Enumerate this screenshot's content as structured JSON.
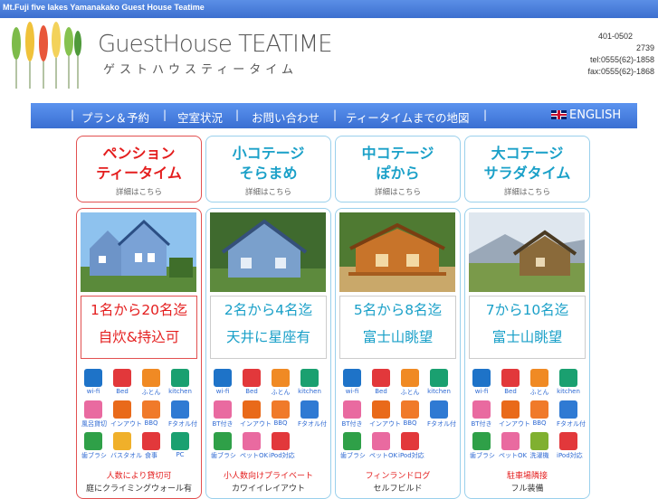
{
  "top_strip": "Mt.Fuji five lakes Yamanakako Guest House Teatime",
  "brand": "GuestHouse TEATIME",
  "brand_kana": "ゲストハウスティータイム",
  "address": {
    "line1": "401-0502",
    "line2": "2739",
    "tel": "tel:0555(62)-1858",
    "fax": "fax:0555(62)-1868"
  },
  "nav": {
    "items": [
      "プラン＆予約",
      "空室状況",
      "お問い合わせ",
      "ティータイムまでの地図"
    ],
    "english": "ENGLISH",
    "separator": "|"
  },
  "columns": [
    {
      "title1": "ペンション",
      "title2": "ティータイム",
      "detail": "詳細はこちら",
      "cap1": "1名から20名迄",
      "cap2": "自炊&持込可",
      "icons": [
        [
          "wifi-icon",
          "wi-fi"
        ],
        [
          "bed-icon",
          "Bed"
        ],
        [
          "futon-icon",
          "ふとん"
        ],
        [
          "kitchen-icon",
          "kitchen"
        ],
        [
          "bath-icon",
          "風呂貸切"
        ],
        [
          "checkin-icon",
          "インアウト"
        ],
        [
          "bbq-icon",
          "BBQ"
        ],
        [
          "towel-icon",
          "Fタオル付"
        ],
        [
          "toiletry-icon",
          "歯ブラシ"
        ],
        [
          "bathtowel-icon",
          "バスタオル"
        ],
        [
          "meal-icon",
          "食事"
        ],
        [
          "pc-icon",
          "PC"
        ]
      ],
      "bottom1": "人数により貸切可",
      "bottom2": "庭にクライミングウォール有"
    },
    {
      "title1": "小コテージ",
      "title2": "そらまめ",
      "detail": "詳細はこちら",
      "cap1": "2名から4名迄",
      "cap2": "天井に星座有",
      "icons": [
        [
          "wifi-icon",
          "wi-fi"
        ],
        [
          "bed-icon",
          "Bed"
        ],
        [
          "futon-icon",
          "ふとん"
        ],
        [
          "kitchen-icon",
          "kitchen"
        ],
        [
          "bath-icon",
          "BT付き"
        ],
        [
          "checkin-icon",
          "インアウト"
        ],
        [
          "bbq-icon",
          "BBQ"
        ],
        [
          "towel-icon",
          "Fタオル付"
        ],
        [
          "toiletry-icon",
          "歯ブラシ"
        ],
        [
          "pet-icon",
          "ペットOK"
        ],
        [
          "ipod-icon",
          "iPod対応"
        ]
      ],
      "bottom1": "小人数向けプライベート",
      "bottom2": "カワイイレイアウト"
    },
    {
      "title1": "中コテージ",
      "title2": "ぽから",
      "detail": "詳細はこちら",
      "cap1": "5名から8名迄",
      "cap2": "富士山眺望",
      "icons": [
        [
          "wifi-icon",
          "wi-fi"
        ],
        [
          "bed-icon",
          "Bed"
        ],
        [
          "futon-icon",
          "ふとん"
        ],
        [
          "kitchen-icon",
          "kitchen"
        ],
        [
          "bath-icon",
          "BT付き"
        ],
        [
          "checkin-icon",
          "インアウト"
        ],
        [
          "bbq-icon",
          "BBQ"
        ],
        [
          "towel-icon",
          "Fタオル付"
        ],
        [
          "toiletry-icon",
          "歯ブラシ"
        ],
        [
          "pet-icon",
          "ペットOK"
        ],
        [
          "ipod-icon",
          "iPod対応"
        ]
      ],
      "bottom1": "フィンランドログ",
      "bottom2": "セルフビルド"
    },
    {
      "title1": "大コテージ",
      "title2": "サラダタイム",
      "detail": "詳細はこちら",
      "cap1": "7から10名迄",
      "cap2": "富士山眺望",
      "icons": [
        [
          "wifi-icon",
          "wi-fi"
        ],
        [
          "bed-icon",
          "Bed"
        ],
        [
          "futon-icon",
          "ふとん"
        ],
        [
          "kitchen-icon",
          "kitchen"
        ],
        [
          "bath-icon",
          "BT付き"
        ],
        [
          "checkin-icon",
          "インアウト"
        ],
        [
          "bbq-icon",
          "BBQ"
        ],
        [
          "towel-icon",
          "Fタオル付"
        ],
        [
          "toiletry-icon",
          "歯ブラシ"
        ],
        [
          "pet-icon",
          "ペットOK"
        ],
        [
          "washer-icon",
          "洗濯機"
        ],
        [
          "ipod-icon",
          "iPod対応"
        ]
      ],
      "bottom1": "駐車場隣接",
      "bottom2": "フル装備"
    }
  ]
}
